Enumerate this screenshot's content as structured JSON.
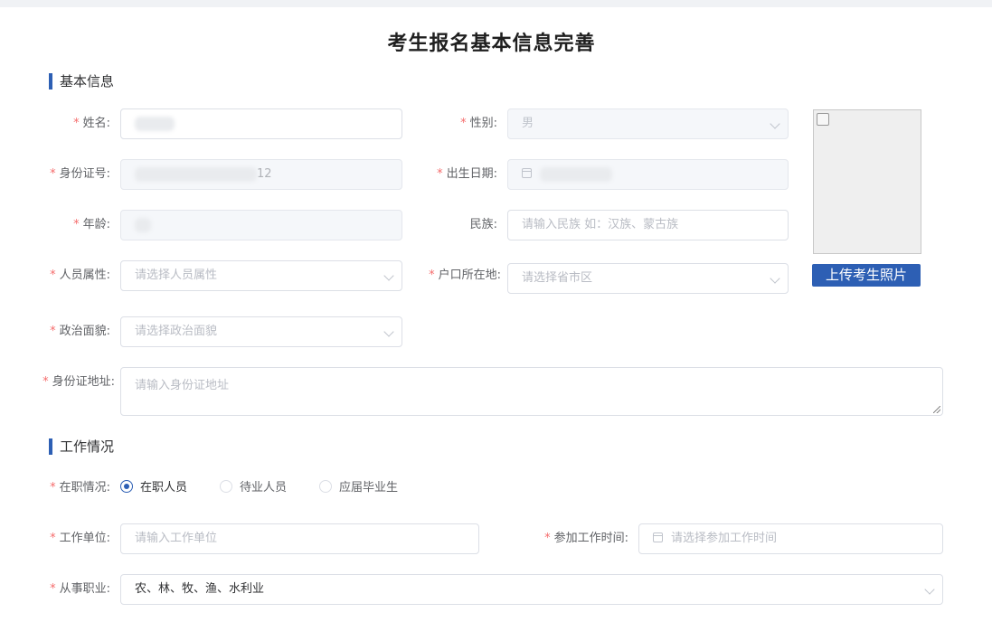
{
  "page_title": "考生报名基本信息完善",
  "sections": {
    "basic": "基本信息",
    "work": "工作情况"
  },
  "required_mark": "*",
  "fields": {
    "name": {
      "label": "姓名:",
      "value": ""
    },
    "gender": {
      "label": "性别:",
      "value": "男"
    },
    "id_number": {
      "label": "身份证号:",
      "value": "12"
    },
    "birth_date": {
      "label": "出生日期:",
      "value": ""
    },
    "age": {
      "label": "年龄:",
      "value": ""
    },
    "ethnicity": {
      "label": "民族:",
      "placeholder": "请输入民族 如：汉族、蒙古族"
    },
    "person_type": {
      "label": "人员属性:",
      "placeholder": "请选择人员属性"
    },
    "household": {
      "label": "户口所在地:",
      "placeholder": "请选择省市区"
    },
    "political": {
      "label": "政治面貌:",
      "placeholder": "请选择政治面貌"
    },
    "id_address": {
      "label": "身份证地址:",
      "placeholder": "请输入身份证地址"
    },
    "employment": {
      "label": "在职情况:",
      "options": [
        "在职人员",
        "待业人员",
        "应届毕业生"
      ],
      "selected": "在职人员"
    },
    "employer": {
      "label": "工作单位:",
      "placeholder": "请输入工作单位"
    },
    "work_start": {
      "label": "参加工作时间:",
      "placeholder": "请选择参加工作时间"
    },
    "occupation": {
      "label": "从事职业:",
      "value": "农、林、牧、渔、水利业"
    }
  },
  "photo": {
    "upload_label": "上传考生照片"
  },
  "colors": {
    "accent": "#2d5fb4",
    "required": "#f56c6c"
  }
}
